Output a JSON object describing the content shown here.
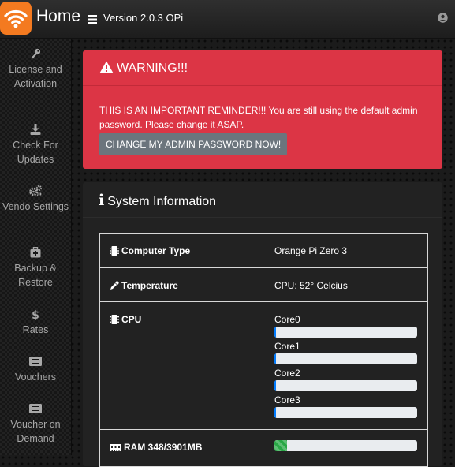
{
  "header": {
    "title": "Home",
    "version": "Version 2.0.3 OPi"
  },
  "sidebar": {
    "items": [
      {
        "label": "License and Activation",
        "icon": "key-icon"
      },
      {
        "label": "Check For Updates",
        "icon": "download-icon"
      },
      {
        "label": "Vendo Settings",
        "icon": "cogs-icon"
      },
      {
        "label": "Backup & Restore",
        "icon": "medkit-icon"
      },
      {
        "label": "Rates",
        "icon": "dollar-icon"
      },
      {
        "label": "Vouchers",
        "icon": "ticket-icon"
      },
      {
        "label": "Voucher on Demand",
        "icon": "ticket-icon"
      }
    ]
  },
  "warning": {
    "title": "WARNING!!!",
    "message": "THIS IS AN IMPORTANT REMINDER!!! You are still using the default admin password. Please change it ASAP.",
    "button": "CHANGE MY ADMIN PASSWORD NOW!"
  },
  "system": {
    "title": "System Information",
    "computer_type_label": "Computer Type",
    "computer_type_value": "Orange Pi Zero 3",
    "temperature_label": "Temperature",
    "temperature_value": "CPU: 52° Celcius",
    "cpu_label": "CPU",
    "cores": [
      {
        "name": "Core0",
        "usage": 0.01
      },
      {
        "name": "Core1",
        "usage": 0.01
      },
      {
        "name": "Core2",
        "usage": 0.01
      },
      {
        "name": "Core3",
        "usage": 0.01
      }
    ],
    "ram_label": "RAM 348/3901MB",
    "ram_usage": 0.09
  },
  "colors": {
    "logo": "#f47a20",
    "warning": "#dc3545",
    "button": "#6c757d",
    "cpu_bar": "#007bff",
    "ram_bar": "#28a745"
  }
}
